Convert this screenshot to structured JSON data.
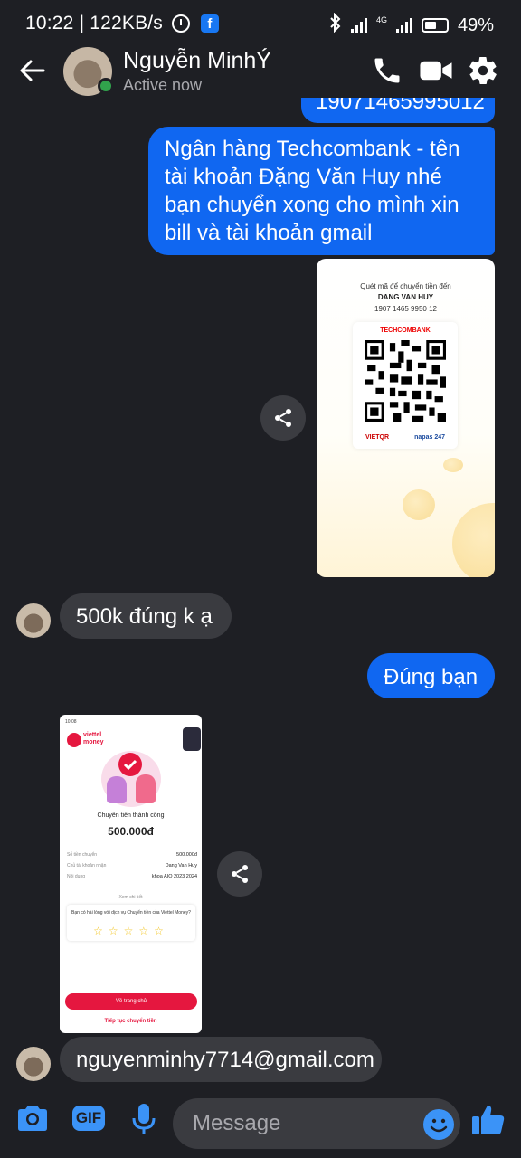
{
  "status_bar": {
    "time": "10:22",
    "speed": "122KB/s",
    "network": "4G",
    "battery": "49%"
  },
  "header": {
    "contact_name": "Nguyễn MinhÝ",
    "status": "Active now"
  },
  "messages": {
    "partial_number": "19071465995012",
    "bank_msg": [
      "Ngân hàng Techcombank - tên",
      "tài khoản Đặng Văn Huy nhé",
      "bạn chuyển xong cho mình xin",
      "bill và tài khoản gmail"
    ],
    "qr": {
      "line1": "Quét mã để chuyển tiền đến",
      "name": "DANG VAN HUY",
      "account": "1907 1465 9950 12",
      "bank": "TECHCOMBANK",
      "vietqr": "VIETQR",
      "napas": "napas 247"
    },
    "incoming_1": "500k đúng k ạ",
    "outgoing_2": "Đúng bạn",
    "receipt": {
      "status_time": "10:08",
      "brand_line1": "viettel",
      "brand_line2": "money",
      "success": "Chuyển tiền thành công",
      "amount": "500.000đ",
      "rows": [
        {
          "label": "Số tiền chuyển",
          "value": "500.000đ"
        },
        {
          "label": "Chủ tài khoản nhận",
          "value": "Dang Van Huy"
        },
        {
          "label": "Nội dung",
          "value": "khoa AIO 2023 2024"
        }
      ],
      "more": "Xem chi tiết",
      "survey": "Bạn có hài lòng với dịch vụ Chuyển tiền của Viettel Money?",
      "stars": "☆☆☆☆☆",
      "button": "Về trang chủ",
      "link": "Tiếp tục chuyển tiền"
    },
    "incoming_2": "nguyenminhy7714@gmail.com"
  },
  "composer": {
    "placeholder": "Message",
    "gif_label": "GIF"
  },
  "colors": {
    "background": "#1e1f24",
    "outgoing": "#1067f1",
    "incoming": "#3a3b40",
    "accent": "#3b93f7"
  }
}
